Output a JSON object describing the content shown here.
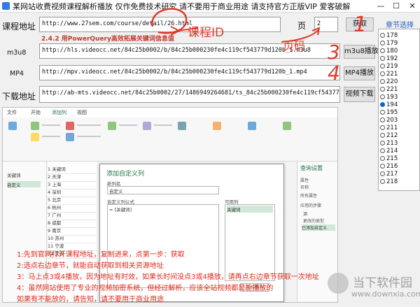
{
  "window": {
    "title": "某网站收费视频课程解析播放 仅作免费技术研究 请不要用于商业用途 请支持官方正版VIP 爱客破解",
    "minimize": "—",
    "maximize": "☐",
    "close": "✕"
  },
  "course": {
    "label": "课程地址",
    "url": "http://www.27sem.com/course/detail/26.html",
    "page_label": "页",
    "page_value": "2",
    "fetch_button": "获取"
  },
  "hint": "2.4.2 用PowerQuery高效拓展关键词信息值",
  "m3u8": {
    "label": "m3u8",
    "url": "http://hls.videocc.net/84c25b0002/b/84c25b000230fe4c119cf543779d120b_1.m3u8",
    "play_button": "m3u8播放"
  },
  "mp4": {
    "label": "MP4",
    "url": "http://mpv.videocc.net/84c25b0002/b/84c25b000230fe4c119cf543779d120b_1.mp4",
    "play_button": "MP4播放"
  },
  "download": {
    "label": "下载地址",
    "url": "http://ab-mts.videocc.net/84c25b0002/27/1486949264681/ts_84c25b000230fe4c119cf543779d120b_1.zip",
    "button": "视频下载"
  },
  "annotations": {
    "course_id": "课程ID",
    "page_code": "页码",
    "step1": "1",
    "step2": "2",
    "step3": "3",
    "step4": "4"
  },
  "chapters": {
    "title": "章节选择",
    "selected": "194",
    "items": [
      "178",
      "179",
      "180",
      "192",
      "219",
      "221",
      "220",
      "221",
      "193",
      "194",
      "195",
      "203",
      "211",
      "212",
      "213",
      "214",
      "215",
      "216",
      "217",
      "218"
    ]
  },
  "screenshot": {
    "ribbon_tabs": [
      "文件",
      "开始",
      "添加列",
      "视图"
    ],
    "dialog_title": "添加自定义列",
    "dialog_new_col_label": "新列名",
    "dialog_new_col_value": "自定义",
    "dialog_formula_label": "自定义列公式",
    "dialog_formula_value": "= [关键词]",
    "dialog_available_label": "可用列",
    "dialog_available_item": "关键词",
    "dialog_insert": "<< 插入",
    "nav_items": [
      "关键词",
      "自定义"
    ],
    "grid_rows": [
      "1 关键词",
      "2 天津",
      "3 上海",
      "4 深圳",
      "5 北京",
      "6 杭州",
      "7 广州",
      "8 成都",
      "9 南京",
      "10 苏州",
      "11 宁波",
      "12 武汉"
    ],
    "right_pane_title": "查询设置",
    "right_pane_items": [
      "属性",
      "名称",
      "所有属性",
      "应用的步骤",
      "源",
      "更改的类型",
      "已添加自定义"
    ]
  },
  "instructions": [
    "1:先到官网打开课程地址，复制进来，点第一步：获取",
    "2:选点右边章节，就能自动获取到相关资源地址",
    "3：马上点3或4播放，因为地址有时效，如果长时间没点3或4播放，请再点右边章节获取一次地址",
    "4：虽然网站使用了专业的视频加密系统，但经过解析，应该全站视频都是能播放的",
    "如果有不能放的，请告知，请不要用于商业用途"
  ],
  "watermark": {
    "cn": "当下软件园",
    "en": "www.downxia.com"
  },
  "colors": {
    "annotation": "#e03a2a",
    "accent": "#1565c0",
    "excel_green": "#217346"
  }
}
